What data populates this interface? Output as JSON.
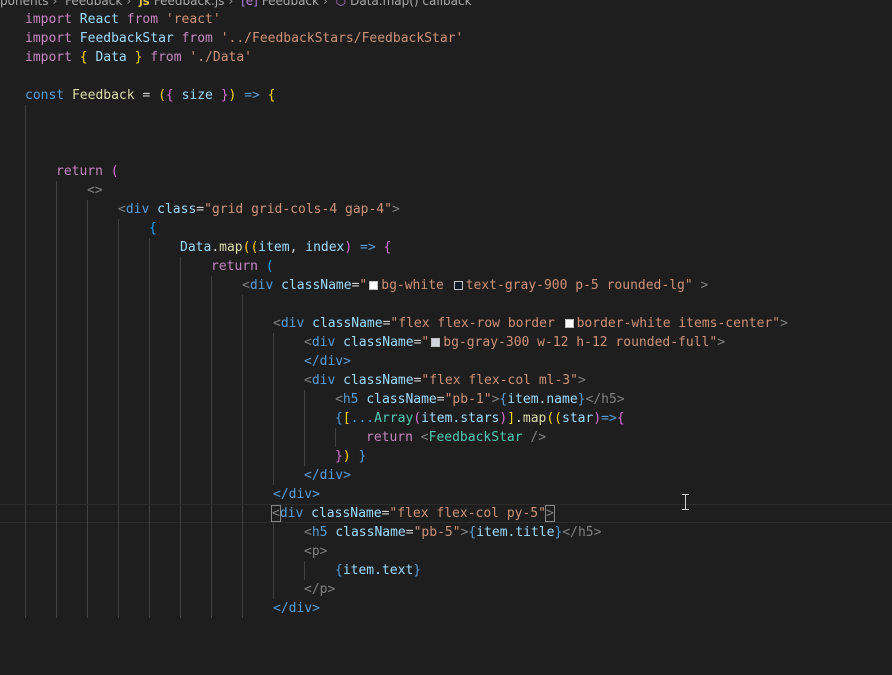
{
  "breadcrumb": {
    "items": [
      "ponents",
      "Feedback",
      "Feedback.js",
      "Feedback",
      "Data.map() callback"
    ]
  },
  "colors": {
    "white": "#ffffff",
    "gray_900": "#111827",
    "gray_300": "#d1d5db"
  },
  "code": {
    "l1": {
      "kw": "import",
      "name": "React",
      "from": "from",
      "str": "'react'"
    },
    "l2": {
      "kw": "import",
      "name": "FeedbackStar",
      "from": "from",
      "str": "'../FeedbackStars/FeedbackStar'"
    },
    "l3": {
      "kw": "import",
      "open": "{",
      "name": "Data",
      "close": "}",
      "from": "from",
      "str": "'./Data'"
    },
    "l5": {
      "kw": "const",
      "name": "Feedback",
      "eq": "=",
      "p1": "(",
      "b1": "{",
      "param": "size",
      "b2": "}",
      "p2": ")",
      "arrow": "=>",
      "brace": "{"
    },
    "l10": {
      "kw": "return",
      "paren": "("
    },
    "l11": {
      "frag": "<>"
    },
    "l12": {
      "open": "<",
      "tag": "div",
      "attr": "class",
      "eq": "=",
      "str": "\"grid grid-cols-4 gap-4\"",
      "close": ">"
    },
    "l13": {
      "brace": "{"
    },
    "l14": {
      "obj": "Data",
      "dot": ".",
      "fn": "map",
      "p1": "((",
      "a1": "item",
      "comma": ", ",
      "a2": "index",
      "p2": ")",
      "arrow": " => ",
      "brace": "{"
    },
    "l15": {
      "kw": "return",
      "paren": "("
    },
    "l16": {
      "open": "<",
      "tag": "div",
      "attr": "className",
      "eq": "=",
      "q1": "\"",
      "c1": "bg-white",
      "c2": "text-gray-900 p-5 rounded-lg",
      "q2": "\"",
      "close": " >"
    },
    "l18": {
      "open": "<",
      "tag": "div",
      "attr": "className",
      "eq": "=",
      "s1": "\"flex flex-row border ",
      "s2": "border-white items-center\"",
      "close": ">"
    },
    "l19": {
      "open": "<",
      "tag": "div",
      "attr": "className",
      "eq": "=",
      "q1": "\"",
      "s1": "bg-gray-300 w-12 h-12 rounded-full\"",
      "close": ">"
    },
    "l20": {
      "tag": "</div>"
    },
    "l21": {
      "open": "<",
      "tag": "div",
      "attr": "className",
      "eq": "=",
      "str": "\"flex flex-col ml-3\"",
      "close": ">"
    },
    "l22": {
      "open": "<",
      "tag": "h5",
      "attr": "className",
      "eq": "=",
      "str": "\"pb-1\"",
      "gt": ">",
      "b1": "{",
      "expr": "item.name",
      "b2": "}",
      "end": "</h5>"
    },
    "l23": {
      "b1": "{",
      "s1": "[",
      "spread": "...",
      "fn": "Array",
      "p1": "(",
      "arg": "item.stars",
      "p2": ")",
      "s2": "]",
      "dot": ".",
      "map": "map",
      "p3": "((",
      "param": "star",
      "p4": ")",
      "arrow": "=>",
      "b2": "{"
    },
    "l24": {
      "kw": "return",
      "open": "<",
      "comp": "FeedbackStar",
      "close": " />"
    },
    "l25": {
      "b1": "}",
      "p1": ")",
      "b2": " }"
    },
    "l26": {
      "tag": "</div>"
    },
    "l27": {
      "tag": "</div>"
    },
    "l28": {
      "open": "<",
      "tag": "div",
      "attr": "className",
      "eq": "=",
      "str": "\"flex flex-col py-5\"",
      "close": ">"
    },
    "l29": {
      "open": "<",
      "tag": "h5",
      "attr": "className",
      "eq": "=",
      "str": "\"pb-5\"",
      "gt": ">",
      "b1": "{",
      "expr": "item.title",
      "b2": "}",
      "end": "</h5>"
    },
    "l30": {
      "tag": "<p>"
    },
    "l31": {
      "b1": "{",
      "expr": "item.text",
      "b2": "}"
    },
    "l32": {
      "tag": "</p>"
    },
    "l33": {
      "tag": "</div>"
    }
  }
}
